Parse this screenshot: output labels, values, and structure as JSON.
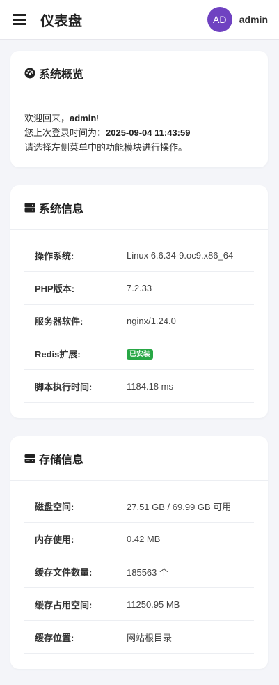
{
  "header": {
    "title": "仪表盘",
    "avatar_initials": "AD",
    "username": "admin",
    "avatar_color": "#6f42c1"
  },
  "overview": {
    "title": "系统概览",
    "icon": "dashboard-icon",
    "welcome_prefix": "欢迎回来，",
    "welcome_user": "admin",
    "welcome_suffix": "!",
    "last_login_label": "您上次登录时间为：",
    "last_login_time": "2025-09-04 11:43:59",
    "hint": "请选择左侧菜单中的功能模块进行操作。"
  },
  "system_info": {
    "title": "系统信息",
    "icon": "server-icon",
    "rows": [
      {
        "key": "操作系统:",
        "value": "Linux 6.6.34-9.oc9.x86_64"
      },
      {
        "key": "PHP版本:",
        "value": "7.2.33"
      },
      {
        "key": "服务器软件:",
        "value": "nginx/1.24.0"
      },
      {
        "key": "Redis扩展:",
        "value": "已安装"
      },
      {
        "key": "脚本执行时间:",
        "value": "1184.18 ms"
      }
    ],
    "badge_color": "#28a745"
  },
  "storage_info": {
    "title": "存储信息",
    "icon": "hdd-icon",
    "rows": [
      {
        "key": "磁盘空间:",
        "value": "27.51 GB / 69.99 GB 可用"
      },
      {
        "key": "内存使用:",
        "value": "0.42 MB"
      },
      {
        "key": "缓存文件数量:",
        "value": "185563 个"
      },
      {
        "key": "缓存占用空间:",
        "value": "11250.95 MB"
      },
      {
        "key": "缓存位置:",
        "value": "网站根目录"
      }
    ]
  }
}
